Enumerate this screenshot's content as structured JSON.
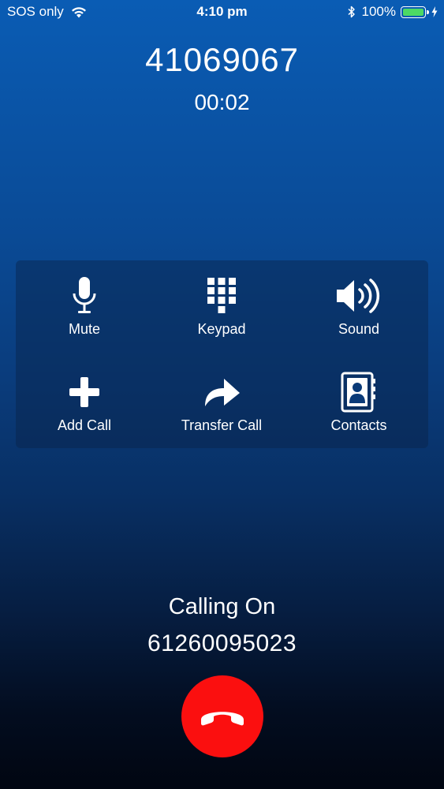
{
  "status_bar": {
    "carrier": "SOS only",
    "time": "4:10 pm",
    "battery_percent": "100%",
    "battery_level": 1.0,
    "battery_color": "#4cd964"
  },
  "call": {
    "number": "41069067",
    "duration": "00:02"
  },
  "controls": [
    {
      "label": "Mute",
      "icon": "microphone-icon"
    },
    {
      "label": "Keypad",
      "icon": "keypad-icon"
    },
    {
      "label": "Sound",
      "icon": "speaker-icon"
    },
    {
      "label": "Add Call",
      "icon": "plus-icon"
    },
    {
      "label": "Transfer Call",
      "icon": "forward-arrow-icon"
    },
    {
      "label": "Contacts",
      "icon": "contacts-book-icon"
    }
  ],
  "calling_on": {
    "label": "Calling On",
    "number": "61260095023"
  },
  "end_call": {
    "icon": "hang-up-phone-icon",
    "color": "#fb0f0f"
  }
}
